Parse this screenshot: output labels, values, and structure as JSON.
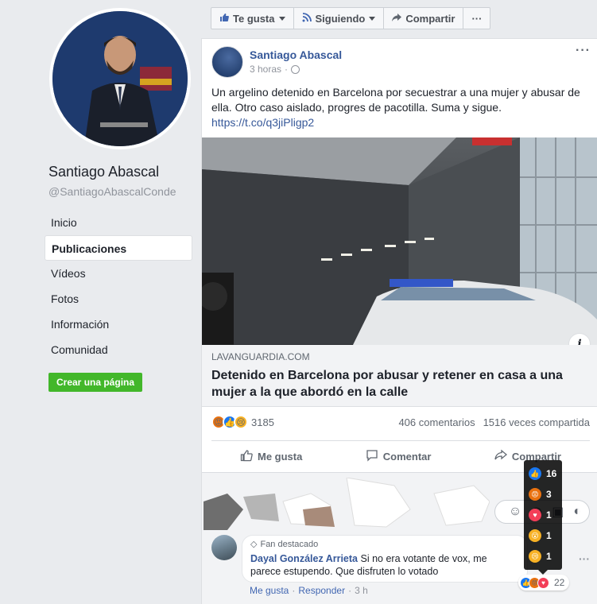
{
  "profile": {
    "name": "Santiago Abascal",
    "handle": "@SantiagoAbascalConde"
  },
  "nav": {
    "items": [
      "Inicio",
      "Publicaciones",
      "Vídeos",
      "Fotos",
      "Información",
      "Comunidad"
    ],
    "active": "Publicaciones"
  },
  "create_page_label": "Crear una página",
  "topbar": {
    "like_label": "Te gusta",
    "follow_label": "Siguiendo",
    "share_label": "Compartir",
    "more_label": "···"
  },
  "post": {
    "author": "Santiago Abascal",
    "time": "3 horas",
    "text": "Un argelino detenido en Barcelona por secuestrar a una mujer y abusar de ella. Otro caso aislado, progres de pacotilla. Suma y sigue.",
    "link": "https://t.co/q3jiPligp2",
    "more": "···",
    "link_preview": {
      "domain": "LAVANGUARDIA.COM",
      "title": "Detenido en Barcelona por abusar y retener en casa a una mujer a la que abordó en la calle",
      "info_icon": "i"
    },
    "reactions": {
      "count": "3185",
      "comments": "406 comentarios",
      "shares": "1516 veces compartida",
      "types": [
        "angry",
        "like",
        "sad"
      ]
    },
    "actions": {
      "like": "Me gusta",
      "comment": "Comentar",
      "share": "Compartir"
    }
  },
  "comment": {
    "badge": "Fan destacado",
    "author": "Dayal González Arrieta",
    "text": "Si no era votante de vox, me parece estupendo. Que disfruten lo votado",
    "like": "Me gusta",
    "reply": "Responder",
    "time": "3 h",
    "reaction_count": "22",
    "more": "···"
  },
  "reaction_tooltip": [
    {
      "type": "like",
      "count": "16"
    },
    {
      "type": "angry",
      "count": "3"
    },
    {
      "type": "love",
      "count": "1"
    },
    {
      "type": "wow",
      "count": "1"
    },
    {
      "type": "sad",
      "count": "1"
    }
  ],
  "colors": {
    "link_blue": "#365899",
    "create_green": "#42b72a",
    "like_blue": "#1877f2",
    "angry_orange": "#e9710f",
    "love_red": "#f33e58",
    "yellow": "#f7b125"
  }
}
